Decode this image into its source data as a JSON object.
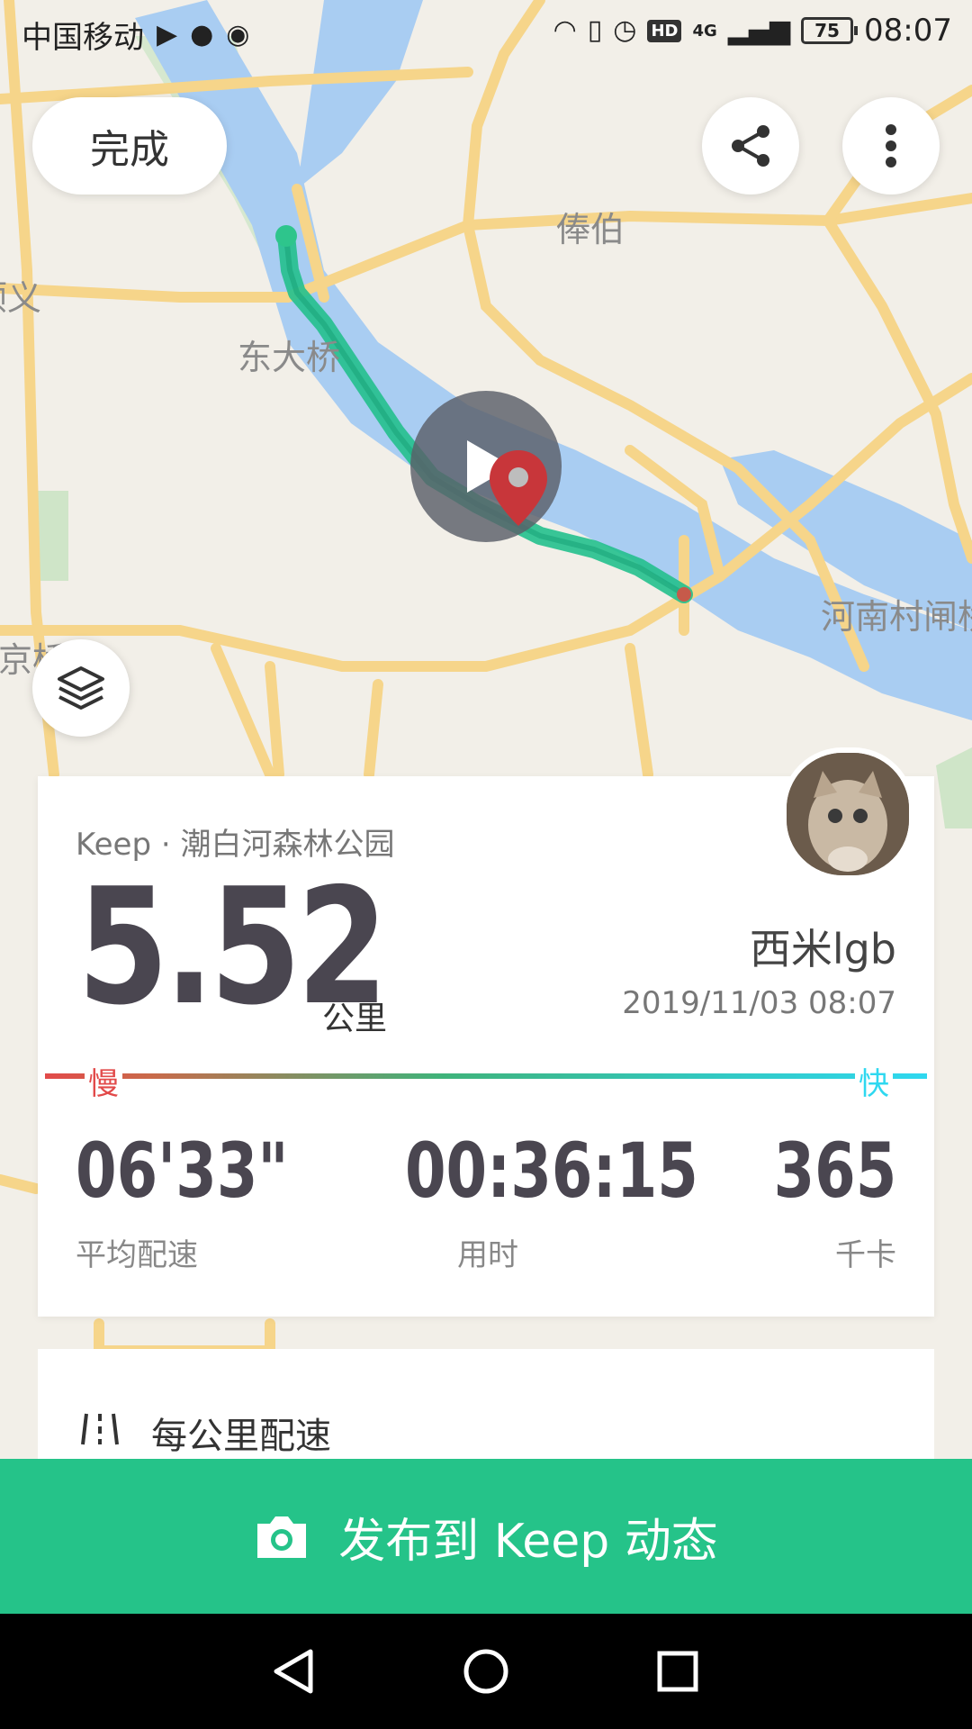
{
  "status_bar": {
    "carrier": "中国移动",
    "battery": "75",
    "time": "08:07",
    "network": "4G",
    "hd": "HD"
  },
  "top_controls": {
    "done_label": "完成",
    "share_icon": "share-icon",
    "more_icon": "more-vertical-icon",
    "layers_icon": "layers-icon"
  },
  "map": {
    "labels": [
      "俸伯",
      "顺义",
      "东大桥",
      "燕京桥",
      "河南村闸桥"
    ],
    "route_color": "#2ec58c",
    "water_color": "#a9cdf2",
    "road_color": "#f6d58a"
  },
  "summary": {
    "source": "Keep · 潮白河森林公园",
    "distance": "5.52",
    "unit": "公里",
    "username": "西米lgb",
    "datetime": "2019/11/03 08:07",
    "slow_label": "慢",
    "fast_label": "快",
    "stats": [
      {
        "value": "06'33\"",
        "label": "平均配速"
      },
      {
        "value": "00:36:15",
        "label": "用时"
      },
      {
        "value": "365",
        "label": "千卡"
      }
    ]
  },
  "pace_section": {
    "title": "每公里配速"
  },
  "publish": {
    "label": "发布到 Keep 动态",
    "color": "#25c389"
  },
  "nav": {
    "back": "back-icon",
    "home": "home-icon",
    "recents": "recents-icon"
  }
}
